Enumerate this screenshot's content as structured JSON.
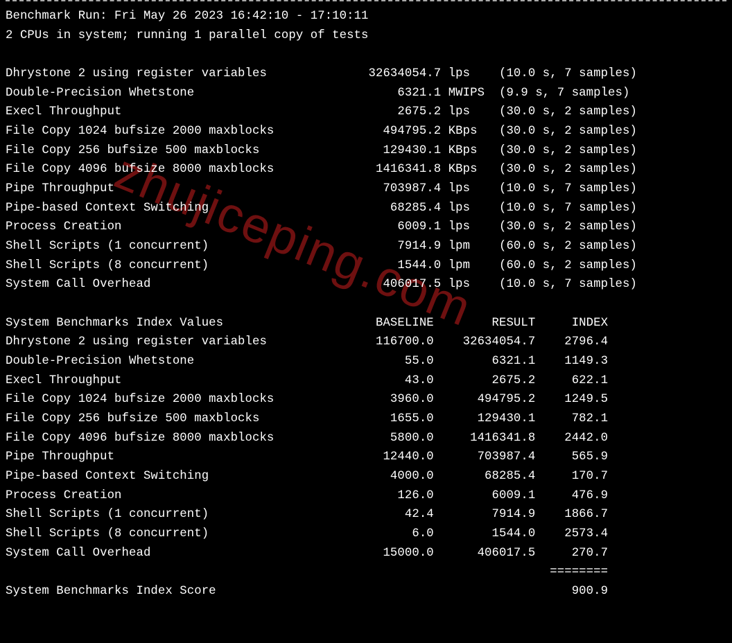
{
  "header": {
    "run_line": "Benchmark Run: Fri May 26 2023 16:42:10 - 17:10:11",
    "cpu_line": "2 CPUs in system; running 1 parallel copy of tests"
  },
  "results": [
    {
      "name": "Dhrystone 2 using register variables",
      "value": "32634054.7",
      "unit": "lps",
      "timing": "(10.0 s, 7 samples)"
    },
    {
      "name": "Double-Precision Whetstone",
      "value": "6321.1",
      "unit": "MWIPS",
      "timing": "(9.9 s, 7 samples)"
    },
    {
      "name": "Execl Throughput",
      "value": "2675.2",
      "unit": "lps",
      "timing": "(30.0 s, 2 samples)"
    },
    {
      "name": "File Copy 1024 bufsize 2000 maxblocks",
      "value": "494795.2",
      "unit": "KBps",
      "timing": "(30.0 s, 2 samples)"
    },
    {
      "name": "File Copy 256 bufsize 500 maxblocks",
      "value": "129430.1",
      "unit": "KBps",
      "timing": "(30.0 s, 2 samples)"
    },
    {
      "name": "File Copy 4096 bufsize 8000 maxblocks",
      "value": "1416341.8",
      "unit": "KBps",
      "timing": "(30.0 s, 2 samples)"
    },
    {
      "name": "Pipe Throughput",
      "value": "703987.4",
      "unit": "lps",
      "timing": "(10.0 s, 7 samples)"
    },
    {
      "name": "Pipe-based Context Switching",
      "value": "68285.4",
      "unit": "lps",
      "timing": "(10.0 s, 7 samples)"
    },
    {
      "name": "Process Creation",
      "value": "6009.1",
      "unit": "lps",
      "timing": "(30.0 s, 2 samples)"
    },
    {
      "name": "Shell Scripts (1 concurrent)",
      "value": "7914.9",
      "unit": "lpm",
      "timing": "(60.0 s, 2 samples)"
    },
    {
      "name": "Shell Scripts (8 concurrent)",
      "value": "1544.0",
      "unit": "lpm",
      "timing": "(60.0 s, 2 samples)"
    },
    {
      "name": "System Call Overhead",
      "value": "406017.5",
      "unit": "lps",
      "timing": "(10.0 s, 7 samples)"
    }
  ],
  "index_header": {
    "title": "System Benchmarks Index Values",
    "col_baseline": "BASELINE",
    "col_result": "RESULT",
    "col_index": "INDEX"
  },
  "index_rows": [
    {
      "name": "Dhrystone 2 using register variables",
      "baseline": "116700.0",
      "result": "32634054.7",
      "index": "2796.4"
    },
    {
      "name": "Double-Precision Whetstone",
      "baseline": "55.0",
      "result": "6321.1",
      "index": "1149.3"
    },
    {
      "name": "Execl Throughput",
      "baseline": "43.0",
      "result": "2675.2",
      "index": "622.1"
    },
    {
      "name": "File Copy 1024 bufsize 2000 maxblocks",
      "baseline": "3960.0",
      "result": "494795.2",
      "index": "1249.5"
    },
    {
      "name": "File Copy 256 bufsize 500 maxblocks",
      "baseline": "1655.0",
      "result": "129430.1",
      "index": "782.1"
    },
    {
      "name": "File Copy 4096 bufsize 8000 maxblocks",
      "baseline": "5800.0",
      "result": "1416341.8",
      "index": "2442.0"
    },
    {
      "name": "Pipe Throughput",
      "baseline": "12440.0",
      "result": "703987.4",
      "index": "565.9"
    },
    {
      "name": "Pipe-based Context Switching",
      "baseline": "4000.0",
      "result": "68285.4",
      "index": "170.7"
    },
    {
      "name": "Process Creation",
      "baseline": "126.0",
      "result": "6009.1",
      "index": "476.9"
    },
    {
      "name": "Shell Scripts (1 concurrent)",
      "baseline": "42.4",
      "result": "7914.9",
      "index": "1866.7"
    },
    {
      "name": "Shell Scripts (8 concurrent)",
      "baseline": "6.0",
      "result": "1544.0",
      "index": "2573.4"
    },
    {
      "name": "System Call Overhead",
      "baseline": "15000.0",
      "result": "406017.5",
      "index": "270.7"
    }
  ],
  "separator": "========",
  "score": {
    "label": "System Benchmarks Index Score",
    "value": "900.9"
  },
  "watermark": "zhujiceping.com"
}
